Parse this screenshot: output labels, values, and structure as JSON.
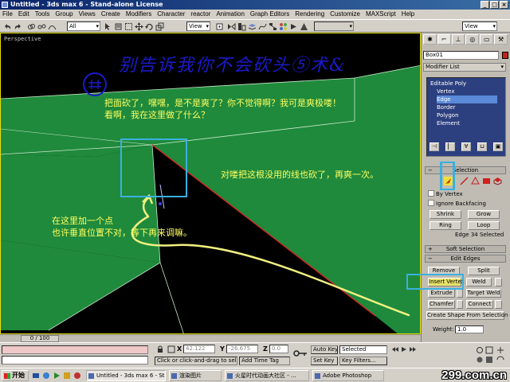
{
  "window": {
    "title": "Untitled - 3ds max 6 - Stand-alone License"
  },
  "menu": [
    "File",
    "Edit",
    "Tools",
    "Group",
    "Views",
    "Create",
    "Modifiers",
    "Character",
    "reactor",
    "Animation",
    "Graph Editors",
    "Rendering",
    "Customize",
    "MAXScript",
    "Help"
  ],
  "toolbar": {
    "selection_filter": "All",
    "ref_coord_1": "View",
    "ref_coord_2": "View"
  },
  "viewport": {
    "label": "Perspective",
    "hand_title": "别告诉我你不会砍头⑤术&",
    "annotations": {
      "a1_line1": "把面砍了，嘿嘿，是不是爽了？你不觉得啊？我可是爽极喽！",
      "a1_line2": "看啊，我在这里做了什么？",
      "a2": "对喽把这根没用的线也砍了，再爽一次。",
      "a3_line1": "在这里加一个点",
      "a3_line2": "也许垂直位置不对，等下再来调嘛。"
    }
  },
  "command_panel": {
    "object_name": "Box01",
    "modifier_list": "Modifier List",
    "stack": [
      "Editable Poly",
      "Vertex",
      "Edge",
      "Border",
      "Polygon",
      "Element"
    ],
    "selection_rollout": "Selection",
    "by_vertex": "By Vertex",
    "ignore_backfacing": "Ignore Backfacing",
    "shrink": "Shrink",
    "grow": "Grow",
    "ring": "Ring",
    "loop": "Loop",
    "sel_status": "Edge 34 Selected",
    "soft_selection": "Soft Selection",
    "edit_edges": "Edit Edges",
    "remove": "Remove",
    "split": "Split",
    "insert_vertex": "Insert Vertex",
    "weld": "Weld",
    "extrude": "Extrude",
    "target_weld": "Target Weld",
    "chamfer": "Chamfer",
    "connect": "Connect",
    "create_shape": "Create Shape From Selection",
    "weight_label": "Weight:",
    "weight_value": "1.0"
  },
  "timeline": {
    "position": "0 / 100"
  },
  "status": {
    "prompt": "Click or click-and-drag to select obj",
    "add_time_tag": "Add Time Tag",
    "x_label": "X",
    "x_value": "42.122",
    "y_label": "Y",
    "y_value": "-26.675",
    "z_label": "Z",
    "z_value": "0.0",
    "auto_key": "Auto Key",
    "auto_key_sel": "Selected",
    "set_key": "Set Key",
    "key_filters": "Key Filters..."
  },
  "taskbar": {
    "start": "开始",
    "tasks": [
      "Untitled - 3ds max 6 - Sta...",
      "渲染图片",
      "火星时代动画大社区 - ...",
      "Adobe Photoshop"
    ],
    "watermark": "299.com.cn"
  },
  "colors": {
    "accent_green": "#1f8a3c",
    "annotation_yellow": "#ffff60",
    "highlight_blue": "#3ab0e0",
    "hand_blue": "#1a1acc"
  }
}
